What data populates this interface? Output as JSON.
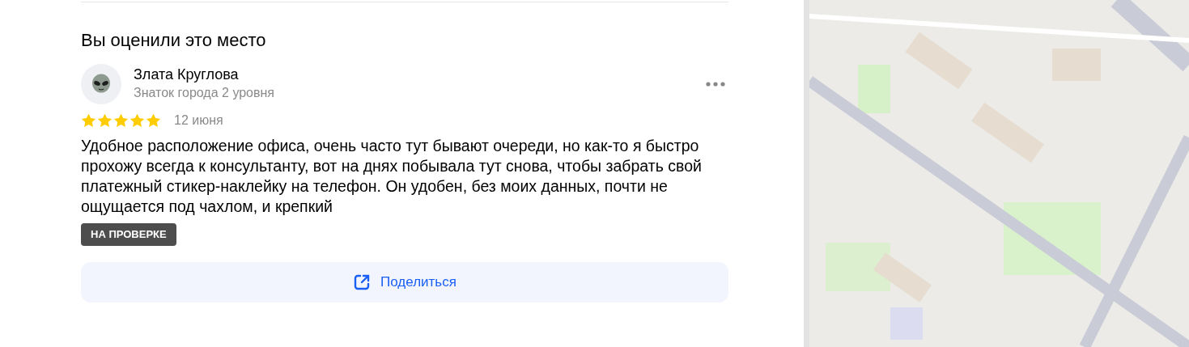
{
  "section_title": "Вы оценили это место",
  "review": {
    "author": "Злата Круглова",
    "author_level": "Знаток города 2 уровня",
    "stars": 5,
    "date": "12 июня",
    "text": "Удобное расположение офиса, очень часто тут бывают очереди, но как-то я быстро прохожу всегда к консультанту, вот на днях побывала тут снова, чтобы забрать свой платежный стикер-наклейку на телефон. Он удобен, без моих данных, почти не ощущается под чахлом, и крепкий",
    "status_badge": "НА ПРОВЕРКЕ"
  },
  "share_button": "Поделиться"
}
